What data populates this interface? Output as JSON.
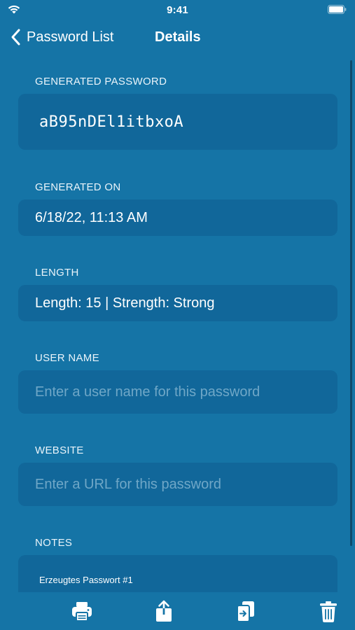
{
  "status": {
    "time": "9:41"
  },
  "nav": {
    "back_label": "Password List",
    "title": "Details"
  },
  "sections": {
    "generated_password": {
      "label": "GENERATED PASSWORD",
      "value": "aB95nDEl1itbxoA"
    },
    "generated_on": {
      "label": "GENERATED ON",
      "value": "6/18/22, 11:13 AM"
    },
    "length": {
      "label": "LENGTH",
      "value": "Length: 15 | Strength: Strong"
    },
    "user_name": {
      "label": "USER NAME",
      "value": "",
      "placeholder": "Enter a user name for this password"
    },
    "website": {
      "label": "WEBSITE",
      "value": "",
      "placeholder": "Enter a URL for this password"
    },
    "notes": {
      "label": "NOTES",
      "value": "Erzeugtes Passwort #1"
    }
  },
  "toolbar": {
    "items": [
      {
        "icon": "printer-icon"
      },
      {
        "icon": "share-icon"
      },
      {
        "icon": "copy-icon"
      },
      {
        "icon": "trash-icon"
      }
    ]
  },
  "colors": {
    "background": "#1574A6",
    "field": "#11679A",
    "placeholder": "#6FA7C7"
  }
}
